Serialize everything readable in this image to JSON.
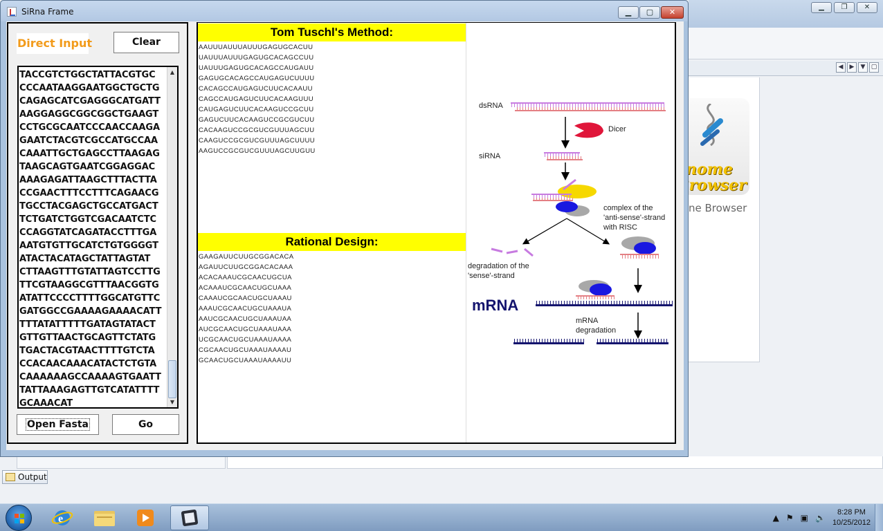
{
  "window": {
    "title": "SiRna Frame",
    "controls": {
      "minimize": "▁",
      "maximize": "▢",
      "close": "✕"
    }
  },
  "left_panel": {
    "direct_input_label": "Direct Input",
    "clear_button": "Clear",
    "sequence_lines": [
      "TACCGTCTGGCTATTACGTGC",
      "CCCAATAAGGAATGGCTGCTG",
      "CAGAGCATCGAGGGCATGATT",
      "AAGGAGGCGGCGGCTGAAGT",
      "CCTGCGCAATCCCAACCAAGA",
      "GAATCTACGTCGCCATGCCAA",
      "CAAATTGCTGAGCCTTAAGAG",
      "TAAGCAGTGAATCGGAGGAC",
      "AAAGAGATTAAGCTTTACTTA",
      "CCGAACTTTCCTTTCAGAACG",
      "TGCCTACGAGCTGCCATGACT",
      "TCTGATCTGGTCGACAATCTC",
      "CCAGGTATCAGATACCTTTGA",
      "AATGTGTTGCATCTGTGGGGT",
      "ATACTACATAGCTATTAGTAT",
      "CTTAAGTTTGTATTAGTCCTTG",
      "TTCGTAAGGCGTTTAACGGTG",
      "ATATTCCCCTTTTGGCATGTTC",
      "GATGGCCGAAAAGAAAACATT",
      "TTTATATTTTTGATAGTATACT",
      "GTTGTTAACTGCAGTTCTATG",
      "TGACTACGTAACTTTTGTCTA",
      "CCACAACAAACATACTCTGTA",
      "CAAAAAAGCCAAAAGTGAATT",
      "TATTAAAGAGTTGTCATATTTT",
      "GCAAACAT"
    ],
    "open_fasta_button": "Open Fasta",
    "go_button": "Go"
  },
  "tuschl": {
    "header": "Tom Tuschl's Method:",
    "oligos": [
      "AAUUUAUUUAUUUGAGUGCACUU",
      "UAUUUAUUUGAGUGCACAGCCUU",
      "UAUUUGAGUGCACAGCCAUGAUU",
      "GAGUGCACAGCCAUGAGUCUUUU",
      "CACAGCCAUGAGUCUUCACAAUU",
      "CAGCCAUGAGUCUUCACAAGUUU",
      "CAUGAGUCUUCACAAGUCCGCUU",
      "GAGUCUUCACAAGUCCGCGUCUU",
      "CACAAGUCCGCGUCGUUUAGCUU",
      "CAAGUCCGCGUCGUUUAGCUUUU",
      "AAGUCCGCGUCGUUUAGCUUGUU"
    ]
  },
  "rational": {
    "header": "Rational Design:",
    "oligos": [
      "GAAGAUUCUUGCGGACACA",
      "AGAUUCUUGCGGACACAAA",
      "ACACAAAUCGCAACUGCUA",
      "ACAAAUCGCAACUGCUAAA",
      "CAAAUCGCAACUGCUAAAU",
      "AAAUCGCAACUGCUAAAUA",
      "AAUCGCAACUGCUAAAUAA",
      "AUCGCAACUGCUAAAUAAA",
      "UCGCAACUGCUAAAUAAAA",
      "CGCAACUGCUAAAUAAAAU",
      "GCAACUGCUAAAUAAAAUU"
    ]
  },
  "diagram": {
    "dsrna": "dsRNA",
    "dicer": "Dicer",
    "sirna": "siRNA",
    "complex_line1": "complex of the",
    "complex_line2": "'anti-sense'-strand",
    "complex_line3": "with RISC",
    "degradation_line1": "degradation of the",
    "degradation_line2": "'sense'-strand",
    "mrna": "mRNA",
    "mrna_deg_line1": "mRNA",
    "mrna_deg_line2": "degradation"
  },
  "background_app": {
    "genome_word1": "enome",
    "genome_word2": "Browser",
    "genome_label": "ne Browser",
    "output_tab": "Output"
  },
  "taskbar": {
    "time": "8:28 PM",
    "date": "10/25/2012"
  },
  "colors": {
    "header_yellow": "#ffff00",
    "direct_input_orange": "#f29b1b",
    "strand_purple": "#c77be0",
    "strand_pink": "#e47f84",
    "mrna_navy": "#14146e",
    "dicer_red": "#e0163a",
    "risc_blue": "#1a18e0",
    "risc_yellow": "#f6d800",
    "risc_gray": "#a8a8a8"
  }
}
